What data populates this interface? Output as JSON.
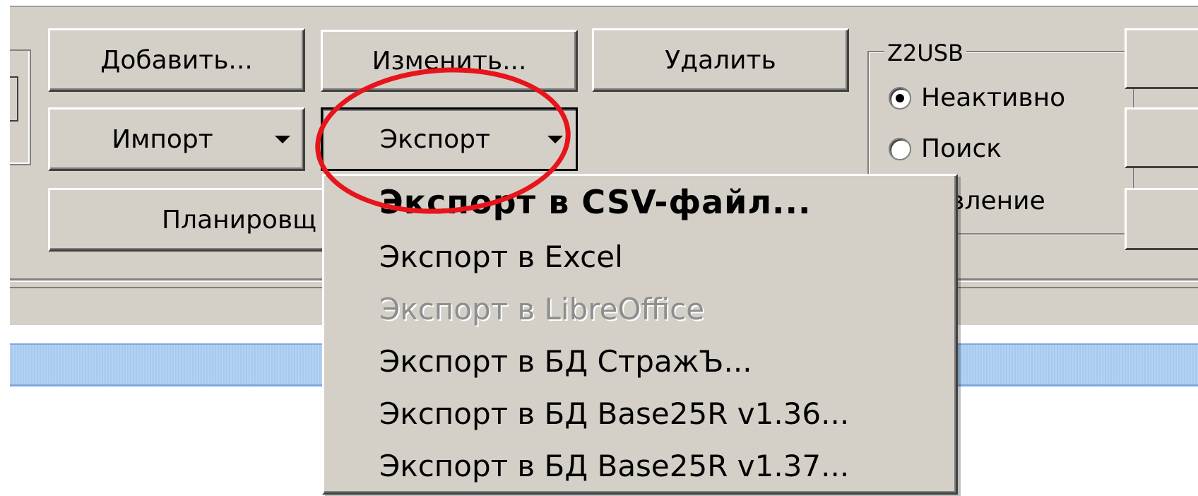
{
  "toolbar": {
    "add_label": "Добавить...",
    "edit_label": "Изменить...",
    "delete_label": "Удалить",
    "import_label": "Импорт",
    "export_label": "Экспорт",
    "scheduler_label": "Планировщ"
  },
  "z2usb": {
    "title": "Z2USB",
    "options": [
      {
        "label": "Неактивно",
        "selected": true
      },
      {
        "label": "Поиск",
        "selected": false
      },
      {
        "label": "бавление",
        "selected": false
      }
    ]
  },
  "export_menu": {
    "items": [
      {
        "label": "Экспорт в CSV-файл...",
        "style": "default"
      },
      {
        "label": "Экспорт в Excel",
        "style": "normal"
      },
      {
        "label": "Экспорт в LibreOffice",
        "style": "disabled"
      },
      {
        "label": "Экспорт в БД СтражЪ...",
        "style": "normal"
      },
      {
        "label": "Экспорт в БД Base25R v1.36...",
        "style": "normal"
      },
      {
        "label": "Экспорт в БД Base25R v1.37...",
        "style": "normal"
      }
    ]
  },
  "colors": {
    "face": "#d4d0c8",
    "highlight_oval": "#e8141b",
    "band": "#a6caf0"
  }
}
